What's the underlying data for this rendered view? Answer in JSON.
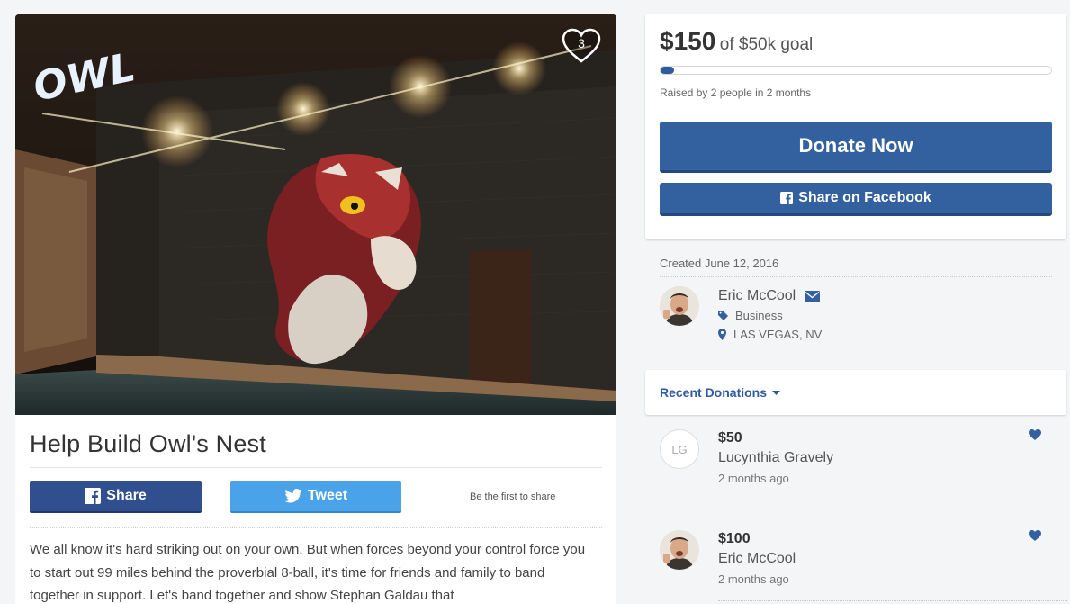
{
  "hero": {
    "sign_text": "OWL",
    "heart_count": "3"
  },
  "campaign": {
    "title": "Help Build Owl's Nest",
    "share_label": "Share",
    "tweet_label": "Tweet",
    "first_share": "Be the first to share",
    "story": "We all know it's hard striking out on your own. But when forces beyond your control force you to start out 99 miles behind the proverbial 8-ball, it's time for friends and family to band together in support. Let's band together and show Stephan Galdau that"
  },
  "donate": {
    "amount": "$150",
    "goal_text": "of $50k goal",
    "progress_fraction": 0.003,
    "raised_by": "Raised by 2 people in 2 months",
    "donate_label": "Donate Now",
    "fb_label": "Share on Facebook"
  },
  "organizer": {
    "created": "Created June 12, 2016",
    "name": "Eric McCool",
    "category": "Business",
    "location": "LAS VEGAS, NV"
  },
  "recent": {
    "title": "Recent Donations",
    "items": [
      {
        "initials": "LG",
        "amount": "$50",
        "name": "Lucynthia Gravely",
        "time": "2 months ago"
      },
      {
        "initials": "",
        "amount": "$100",
        "name": "Eric McCool",
        "time": "2 months ago"
      }
    ]
  },
  "colors": {
    "primary": "#33609e",
    "facebook": "#2f4f8f",
    "twitter": "#4aa3e8",
    "page_bg": "#f4f5f7"
  }
}
